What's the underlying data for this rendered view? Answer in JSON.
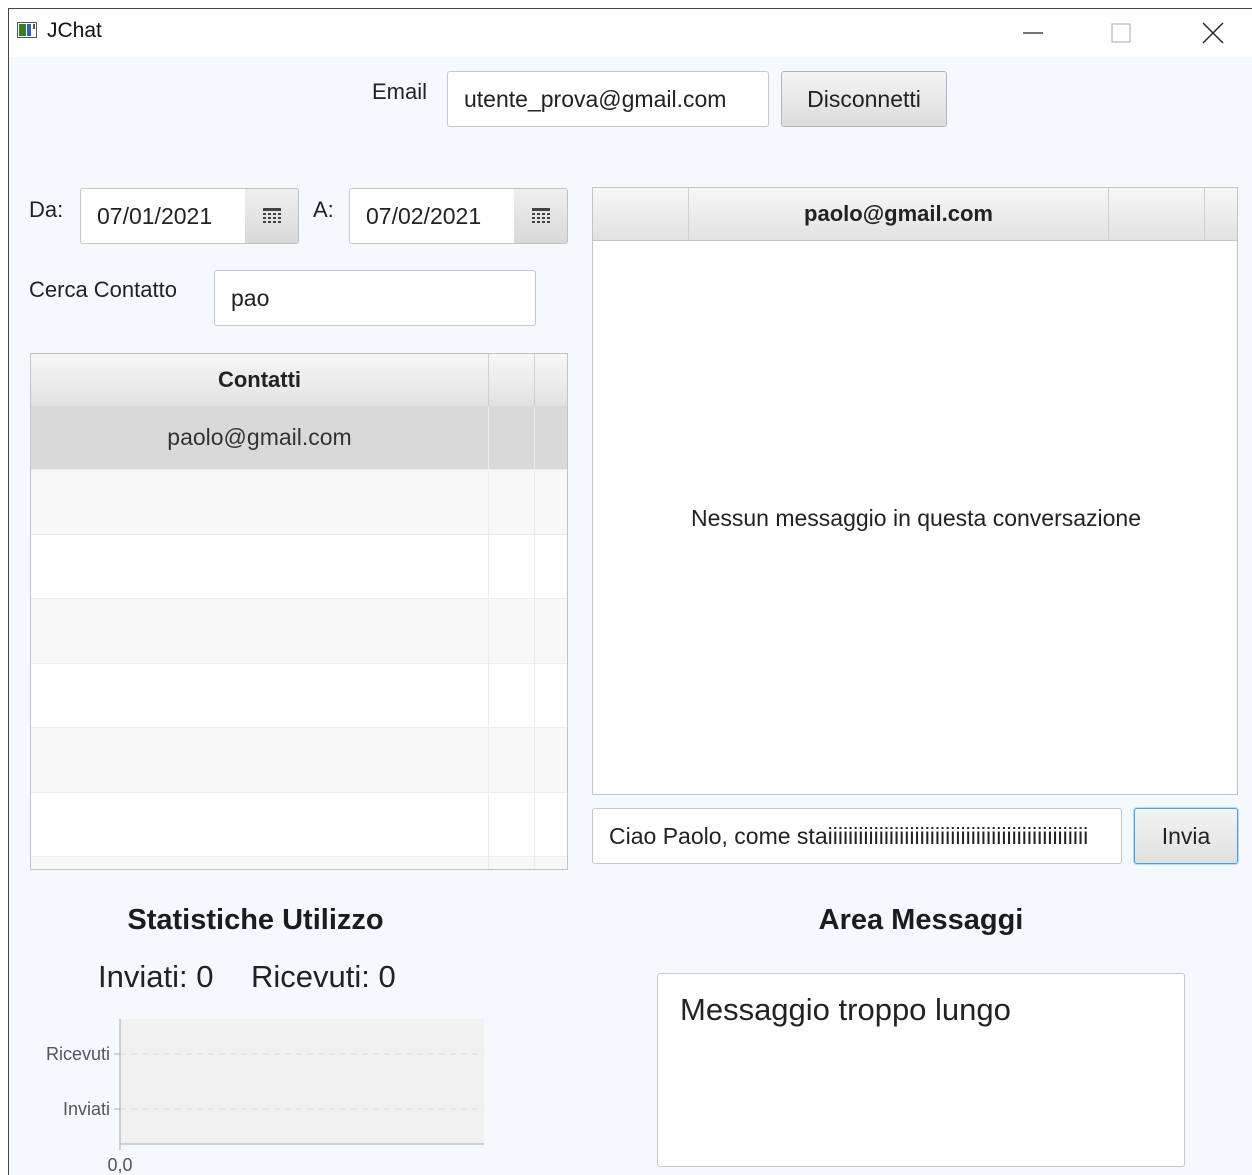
{
  "window": {
    "title": "JChat"
  },
  "header": {
    "email_label": "Email",
    "email_value": "utente_prova@gmail.com",
    "disconnect_label": "Disconnetti"
  },
  "filters": {
    "from_label": "Da:",
    "from_value": "07/01/2021",
    "to_label": "A:",
    "to_value": "07/02/2021",
    "search_label": "Cerca Contatto",
    "search_value": "pao"
  },
  "contacts": {
    "header": "Contatti",
    "rows": [
      "paolo@gmail.com",
      "",
      "",
      "",
      "",
      "",
      ""
    ]
  },
  "conversation": {
    "header": "paolo@gmail.com",
    "empty_text": "Nessun messaggio in questa conversazione",
    "input_value": "Ciao Paolo, come staiiiiiiiiiiiiiiiiiiiiiiiiiiiiiiiiiiiiiiiiiiiiiiiiiii",
    "send_label": "Invia"
  },
  "stats": {
    "title": "Statistiche Utilizzo",
    "sent_text": "Inviati: 0",
    "received_text": "Ricevuti: 0"
  },
  "messages_area": {
    "title": "Area Messaggi",
    "text": "Messaggio troppo lungo"
  },
  "chart_data": {
    "type": "bar",
    "orientation": "horizontal",
    "categories": [
      "Ricevuti",
      "Inviati"
    ],
    "values": [
      0,
      0
    ],
    "x_tick_labels": [
      "0,0"
    ],
    "grid": true
  },
  "colors": {
    "background": "#f4f9fe",
    "selected_row": "#d9d9d9",
    "focus": "#4ba0dc"
  }
}
